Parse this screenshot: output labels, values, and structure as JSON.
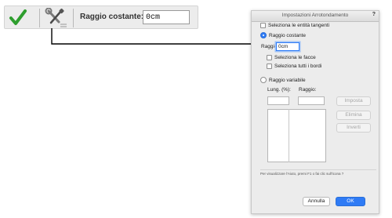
{
  "toolbar": {
    "check_icon": "checkmark-icon",
    "tools_icon": "wrench-screwdriver-icon",
    "label": "Raggio costante:",
    "value": "0cm"
  },
  "dialog": {
    "title": "Impostazioni Arrotondamento",
    "help_icon_label": "?",
    "select_tangent": "Seleziona le entità tangenti",
    "constant_radius": "Raggio costante",
    "radius_label": "Raggio:",
    "radius_value": "0cm",
    "select_faces": "Seleziona le facce",
    "select_all_edges": "Seleziona tutti i bordi",
    "variable_radius": "Raggio variabile",
    "col_length": "Lung. (%):",
    "col_radius": "Raggio:",
    "btn_set": "Imposta",
    "btn_delete": "Elimina",
    "btn_invert": "Inverti",
    "help_text": "Per visualizzare l'Aiuto, premi F1 o fai clic sull'icona ?",
    "btn_cancel": "Annulla",
    "btn_ok": "OK"
  },
  "colors": {
    "accent": "#2f7bf5",
    "check_green": "#2e9e2e"
  }
}
